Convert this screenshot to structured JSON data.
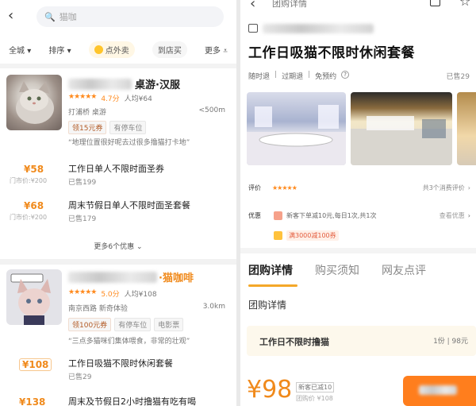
{
  "left": {
    "search_placeholder": "猫咖",
    "filters": [
      "全城",
      "排序",
      "点外卖",
      "到店买",
      "更多"
    ],
    "shops": [
      {
        "name_visible": "桌游·汉服",
        "rating": "4.7分",
        "per_capita": "人均¥64",
        "location": "打浦桥 桌游",
        "distance": "<500m",
        "tags": [
          "领15元券",
          "有停车位"
        ],
        "quote": "“地理位置很好呢去过很多撸猫打卡地”",
        "deals": [
          {
            "price": "¥58",
            "orig": "门市价:¥200",
            "title": "工作日单人不限时面圣券",
            "sold": "已售199"
          },
          {
            "price": "¥68",
            "orig": "门市价:¥200",
            "title": "周末节假日单人不限时面圣套餐",
            "sold": "已售179"
          }
        ],
        "more": "更多6个优惠"
      },
      {
        "name_visible": "·猫咖啡",
        "rating": "5.0分",
        "per_capita": "人均¥108",
        "location": "南京西路 新奇体验",
        "distance": "3.0km",
        "tags": [
          "领100元券",
          "有停车位",
          "电影票"
        ],
        "quote": "“三点多猫咪们集体喂食，非常的壮观”",
        "deals": [
          {
            "price": "¥108",
            "orig": "",
            "title": "工作日吸猫不限时休闲套餐",
            "sold": "已售29"
          },
          {
            "price": "¥138",
            "orig": "",
            "title": "周末及节假日2小时撸猫有吃有喝",
            "sold": ""
          }
        ]
      }
    ]
  },
  "right": {
    "nav_title": "团购详情",
    "title": "工作日吸猫不限时休闲套餐",
    "chips": [
      "随时退",
      "过期退",
      "免预约"
    ],
    "sold": "已售29",
    "rating_label": "评价",
    "rating_right": "共3个消费评价",
    "promo_label": "优惠",
    "promo1": "新客下单减10元,每日1次,共1次",
    "promo1_right": "查看优惠",
    "promo2": "满3000减100券",
    "tabs": [
      "团购详情",
      "购买须知",
      "网友点评"
    ],
    "section": "团购详情",
    "package_title": "工作日不限时撸猫",
    "package_right": "1份 | 98元",
    "price": "¥98",
    "price_badge": "新客已减10",
    "price_orig": "团购价 ¥108"
  }
}
